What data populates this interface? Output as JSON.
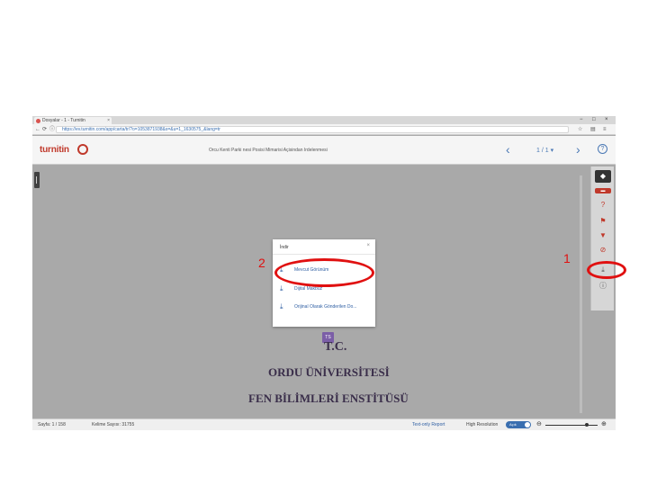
{
  "browser": {
    "tab_title": "Dosyalar - 1 - Turnitin",
    "tab_close": "×",
    "url": "https://ev.turnitin.com/app/carta/tr/?o=1053871938&s=&u=1_1630575_&lang=tr",
    "window_controls": [
      "−",
      "□",
      "×"
    ],
    "toolbar_icons": [
      "☆",
      "▤",
      "≡"
    ],
    "nav_icons": [
      "←",
      "⟳",
      "ⓘ"
    ]
  },
  "header": {
    "logo_text": "turnitin",
    "doc_title": "Orcu Kenti Parki nesi Posisi Mimarisi Açisindan Irdelenmesi",
    "prev_icon": "‹",
    "next_icon": "›",
    "pager": "1 / 1 ▾",
    "help_icon": "?"
  },
  "toolbar": {
    "items": [
      {
        "name": "layers-icon",
        "glyph": "◆"
      },
      {
        "name": "similarity-icon",
        "glyph": "▬"
      },
      {
        "name": "score-icon",
        "glyph": "?"
      },
      {
        "name": "flags-icon",
        "glyph": "⚑"
      },
      {
        "name": "filter-icon",
        "glyph": "▼"
      },
      {
        "name": "exclude-icon",
        "glyph": "⊘"
      },
      {
        "name": "download-icon",
        "glyph": "⤓"
      },
      {
        "name": "info-icon",
        "glyph": "ⓘ"
      }
    ]
  },
  "modal": {
    "title": "İndir",
    "close": "×",
    "options": [
      {
        "label": "Mevcut Görünüm",
        "icon": "⤓"
      },
      {
        "label": "Dijital Makbuz",
        "icon": "⤓"
      },
      {
        "label": "Orijinal Olarak Gönderilen Do...",
        "icon": "⤓"
      }
    ]
  },
  "document": {
    "page_badge": "TS",
    "lines": [
      "T.C.",
      "ORDU ÜNİVERSİTESİ",
      "FEN BİLİMLERİ ENSTİTÜSÜ"
    ]
  },
  "status": {
    "page_count": "Sayfa: 1 / 158",
    "word_count": "Kelime Sayısı: 31755",
    "text_only": "Text-only Report",
    "high_res": "High Resolution",
    "toggle": "Açık",
    "zoom_out_icon": "⊖",
    "zoom_in_icon": "⊕"
  },
  "annotations": {
    "label_1": "1",
    "label_2": "2",
    "color": "#e01010"
  }
}
